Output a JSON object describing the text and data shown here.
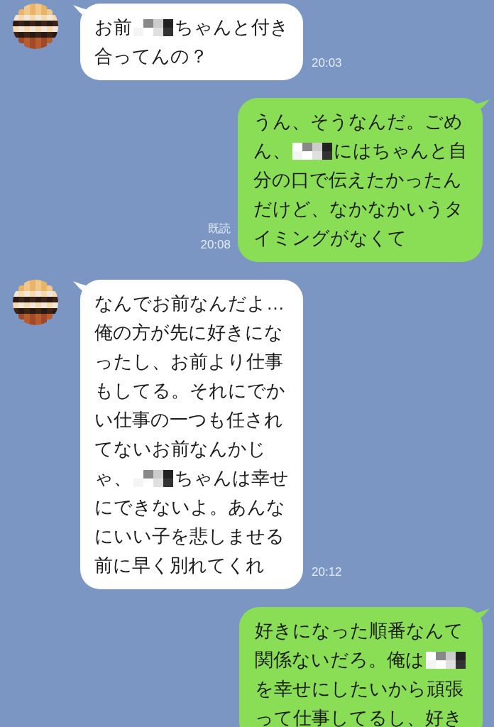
{
  "messages": [
    {
      "kind": "incoming",
      "time": "20:03",
      "lines": [
        [
          {
            "kind": "text",
            "text": "お前"
          },
          {
            "kind": "mosaic"
          },
          {
            "kind": "text",
            "text": "ちゃんと付き"
          }
        ],
        [
          {
            "kind": "text",
            "text": "合ってんの？"
          }
        ]
      ]
    },
    {
      "kind": "outgoing",
      "read": "既読",
      "time": "20:08",
      "lines": [
        [
          {
            "kind": "text",
            "text": "うん、そうなんだ。ごめ"
          }
        ],
        [
          {
            "kind": "text",
            "text": "ん、"
          },
          {
            "kind": "mosaic"
          },
          {
            "kind": "text",
            "text": "にはちゃんと自"
          }
        ],
        [
          {
            "kind": "text",
            "text": "分の口で伝えたかったん"
          }
        ],
        [
          {
            "kind": "text",
            "text": "だけど、なかなかいうタ"
          }
        ],
        [
          {
            "kind": "text",
            "text": "イミングがなくて"
          }
        ]
      ]
    },
    {
      "kind": "incoming",
      "time": "20:12",
      "lines": [
        [
          {
            "kind": "text",
            "text": "なんでお前なんだよ…"
          }
        ],
        [
          {
            "kind": "text",
            "text": "俺の方が先に好きにな"
          }
        ],
        [
          {
            "kind": "text",
            "text": "ったし、お前より仕事"
          }
        ],
        [
          {
            "kind": "text",
            "text": "もしてる。それにでか"
          }
        ],
        [
          {
            "kind": "text",
            "text": "い仕事の一つも任され"
          }
        ],
        [
          {
            "kind": "text",
            "text": "てないお前なんかじ"
          }
        ],
        [
          {
            "kind": "text",
            "text": "ゃ、"
          },
          {
            "kind": "mosaic"
          },
          {
            "kind": "text",
            "text": "ちゃんは幸せ"
          }
        ],
        [
          {
            "kind": "text",
            "text": "にできないよ。あんな"
          }
        ],
        [
          {
            "kind": "text",
            "text": "にいい子を悲しませる"
          }
        ],
        [
          {
            "kind": "text",
            "text": "前に早く別れてくれ"
          }
        ]
      ]
    },
    {
      "kind": "outgoing",
      "lines": [
        [
          {
            "kind": "text",
            "text": "好きになった順番なんて"
          }
        ],
        [
          {
            "kind": "text",
            "text": "関係ないだろ。俺は"
          },
          {
            "kind": "mosaic"
          }
        ],
        [
          {
            "kind": "text",
            "text": "を幸せにしたいから頑張"
          }
        ],
        [
          {
            "kind": "text",
            "text": "って仕事してるし、好き"
          }
        ]
      ]
    }
  ]
}
